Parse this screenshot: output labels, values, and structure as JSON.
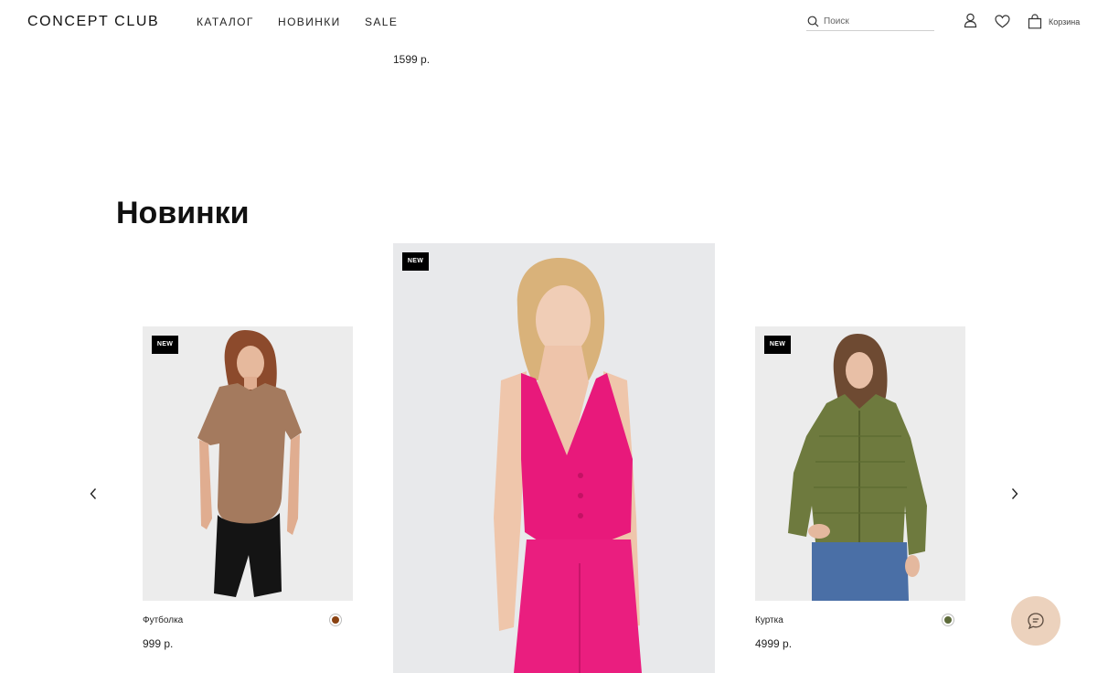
{
  "header": {
    "logo": "CONCEPT CLUB",
    "nav": [
      {
        "label": "КАТАЛОГ"
      },
      {
        "label": "НОВИНКИ"
      },
      {
        "label": "SALE"
      }
    ],
    "search": {
      "placeholder": "Поиск",
      "value": "",
      "icon": "search-icon"
    },
    "icons": [
      "user-icon",
      "heart-icon",
      "bag-icon"
    ],
    "cart_label": "Корзина"
  },
  "previous_section": {
    "price": "1599 р."
  },
  "section": {
    "title": "Новинки"
  },
  "products": [
    {
      "badge": "NEW",
      "name": "Футболка",
      "price": "999 р.",
      "swatch_color": "#8a4212"
    },
    {
      "badge": "NEW",
      "name": "",
      "price": ""
    },
    {
      "badge": "NEW",
      "name": "Куртка",
      "price": "4999 р.",
      "swatch_color": "#5d6b3a"
    }
  ],
  "carousel": {
    "prev_icon": "chevron-left-icon",
    "next_icon": "chevron-right-icon"
  },
  "chat": {
    "icon": "chat-icon",
    "color": "#ecd2bd"
  },
  "colors": {
    "badge_bg": "#000000",
    "text": "#111111"
  }
}
